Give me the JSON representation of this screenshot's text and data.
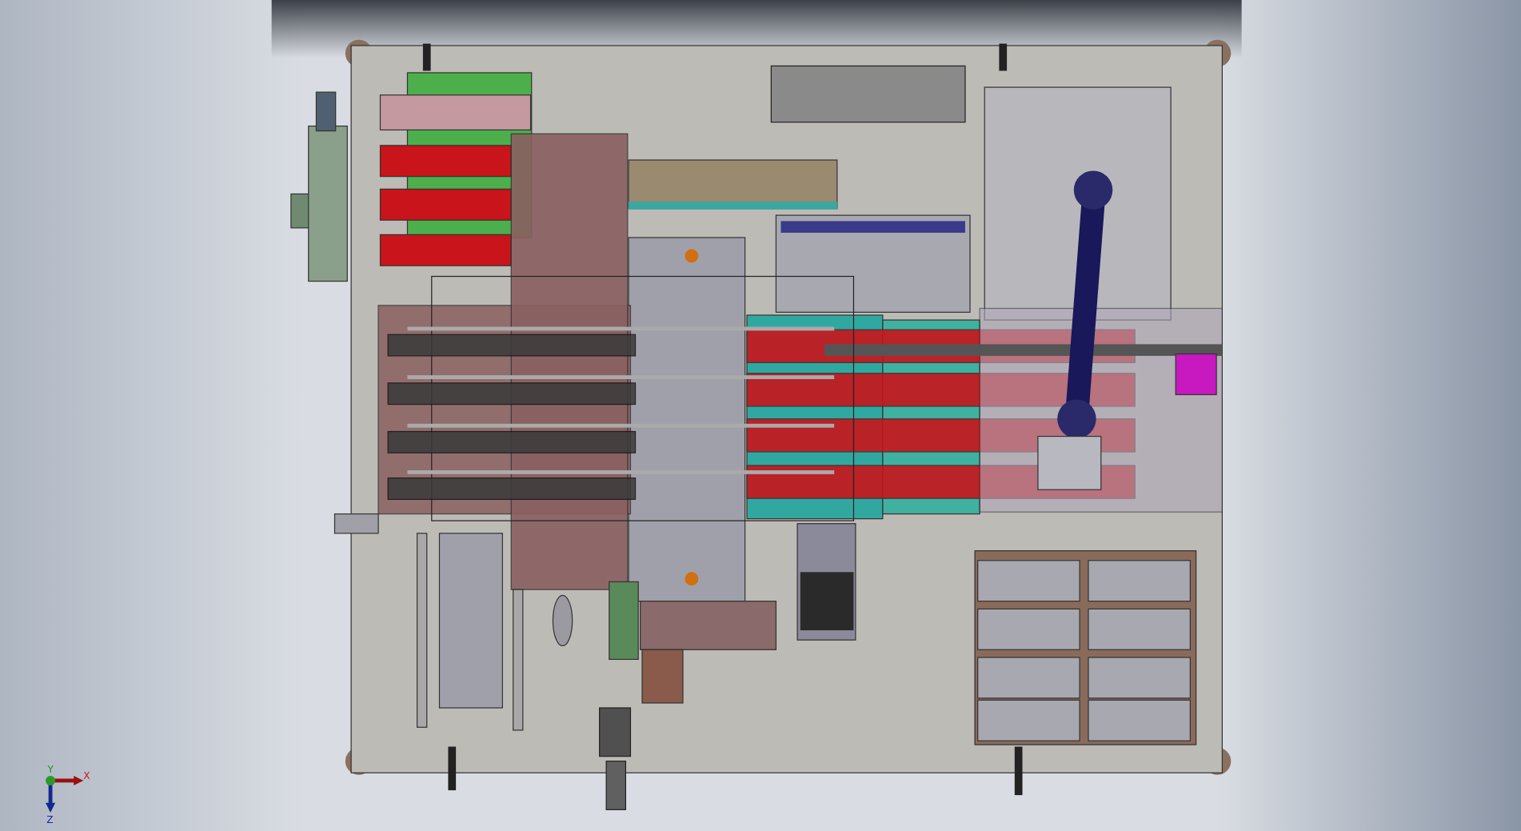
{
  "viewport": {
    "triad": {
      "x_label": "X",
      "y_label": "Y",
      "z_label": "Z"
    }
  }
}
